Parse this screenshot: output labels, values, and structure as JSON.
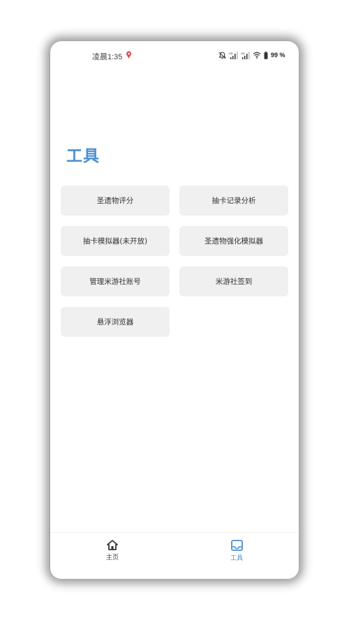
{
  "status_bar": {
    "time": "凌晨1:35",
    "battery_text": "99 %",
    "location_icon": "location-pin-icon",
    "icons": [
      "notifications-off-icon",
      "signal-hd-icon",
      "signal-hd-icon",
      "wifi-icon",
      "battery-icon"
    ]
  },
  "page": {
    "title": "工具"
  },
  "tools": [
    {
      "label": "圣遗物评分"
    },
    {
      "label": "抽卡记录分析"
    },
    {
      "label": "抽卡模拟器(未开放)"
    },
    {
      "label": "圣遗物强化模拟器"
    },
    {
      "label": "管理米游社账号"
    },
    {
      "label": "米游社签到"
    },
    {
      "label": "悬浮浏览器"
    }
  ],
  "bottom_nav": {
    "items": [
      {
        "label": "主页",
        "icon": "home-icon",
        "active": false
      },
      {
        "label": "工具",
        "icon": "tray-icon",
        "active": true
      }
    ]
  },
  "colors": {
    "accent": "#4a8fd0",
    "button_bg": "#f0f0f0",
    "text": "#333333"
  }
}
